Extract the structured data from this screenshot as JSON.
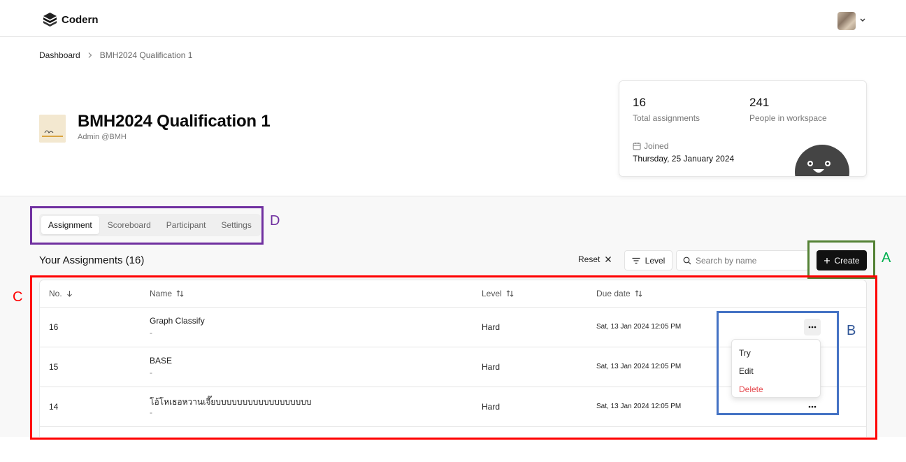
{
  "app": {
    "name": "Codern"
  },
  "breadcrumb": {
    "home": "Dashboard",
    "current": "BMH2024 Qualification 1"
  },
  "workspace": {
    "title": "BMH2024 Qualification 1",
    "subtitle": "Admin @BMH",
    "logo_text": [
      "BANGMOD",
      "HACKATHON",
      "2024"
    ]
  },
  "stats": {
    "total_assignments": "16",
    "total_assignments_label": "Total assignments",
    "people": "241",
    "people_label": "People in workspace",
    "joined_label": "Joined",
    "joined_date": "Thursday, 25 January 2024"
  },
  "tabs": [
    {
      "label": "Assignment",
      "active": true
    },
    {
      "label": "Scoreboard",
      "active": false
    },
    {
      "label": "Participant",
      "active": false
    },
    {
      "label": "Settings",
      "active": false
    }
  ],
  "section": {
    "title": "Your Assignments (16)"
  },
  "toolbar": {
    "reset_label": "Reset",
    "level_label": "Level",
    "search_placeholder": "Search by name",
    "search_value": "",
    "create_label": "Create"
  },
  "table": {
    "headers": {
      "no": "No.",
      "name": "Name",
      "level": "Level",
      "due": "Due date"
    },
    "rows": [
      {
        "no": "16",
        "name": "Graph Classify",
        "desc": "-",
        "level": "Hard",
        "due": "Sat, 13 Jan 2024 12:05 PM"
      },
      {
        "no": "15",
        "name": "BASE",
        "desc": "-",
        "level": "Hard",
        "due": "Sat, 13 Jan 2024 12:05 PM"
      },
      {
        "no": "14",
        "name": "โอ้โหเธอหวานเจี๊ยบบบบบบบบบบบบบบบบบบ",
        "desc": "-",
        "level": "Hard",
        "due": "Sat, 13 Jan 2024 12:05 PM"
      }
    ]
  },
  "row_menu": {
    "items": [
      "Try",
      "Edit",
      "Delete"
    ]
  },
  "annotations": [
    {
      "label": "A",
      "color": "#548235"
    },
    {
      "label": "B",
      "color": "#4472c4"
    },
    {
      "label": "C",
      "color": "#ff0000"
    },
    {
      "label": "D",
      "color": "#7030a0"
    }
  ],
  "colors": {
    "primary_button": "#111111",
    "danger": "#e5484d",
    "background_lower": "#f8f8f8"
  }
}
